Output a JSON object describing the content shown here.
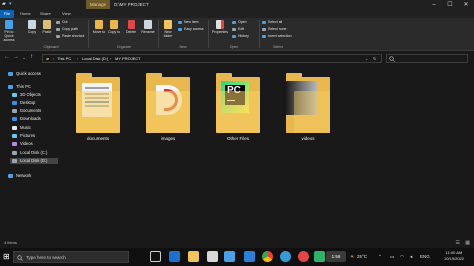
{
  "window": {
    "title": "D:\\MY PROJECT",
    "manage_tab": "Manage",
    "picture_tools_tab": "Picture Tools",
    "controls": [
      "–",
      "☐",
      "✕"
    ]
  },
  "ribbon": {
    "tabs": [
      "File",
      "Home",
      "Share",
      "View"
    ],
    "clipboard": {
      "pin_label": "Pin to Quick access",
      "copy_label": "Copy",
      "paste_label": "Paste",
      "cut_label": "Cut",
      "copy_path_label": "Copy path",
      "paste_shortcut_label": "Paste shortcut",
      "group_label": "Clipboard"
    },
    "organize": {
      "move_to_label": "Move to",
      "copy_to_label": "Copy to",
      "delete_label": "Delete",
      "rename_label": "Rename",
      "group_label": "Organize"
    },
    "new": {
      "new_folder_label": "New folder",
      "new_item_label": "New item",
      "easy_access_label": "Easy access",
      "group_label": "New"
    },
    "open": {
      "properties_label": "Properties",
      "open_label": "Open",
      "edit_label": "Edit",
      "history_label": "History",
      "group_label": "Open"
    },
    "select": {
      "select_all_label": "Select all",
      "select_none_label": "Select none",
      "invert_selection_label": "Invert selection",
      "group_label": "Select"
    }
  },
  "navigation": {
    "crumbs": [
      "This PC",
      "Local Disk (D:)",
      "MY PROJECT"
    ]
  },
  "sidebar": {
    "items": [
      {
        "label": "Quick access",
        "icon": "star-icon",
        "color": "#4aa0e6"
      },
      {
        "label": "This PC",
        "icon": "computer-icon",
        "color": "#4aa0e6"
      },
      {
        "label": "3D Objects",
        "icon": "cube-icon",
        "color": "#6ec6f0"
      },
      {
        "label": "Desktop",
        "icon": "desktop-icon",
        "color": "#3a8ee6"
      },
      {
        "label": "Documents",
        "icon": "documents-icon",
        "color": "#9aa4b0"
      },
      {
        "label": "Downloads",
        "icon": "download-icon",
        "color": "#3a8ee6"
      },
      {
        "label": "Music",
        "icon": "music-icon",
        "color": "#e6e6e6"
      },
      {
        "label": "Pictures",
        "icon": "pictures-icon",
        "color": "#6ec6f0"
      },
      {
        "label": "Videos",
        "icon": "videos-icon",
        "color": "#b48ce6"
      },
      {
        "label": "Local Disk (C:)",
        "icon": "drive-icon",
        "color": "#9aa4b0"
      },
      {
        "label": "Local Disk (D:)",
        "icon": "drive-icon",
        "color": "#9aa4b0"
      },
      {
        "label": "Network",
        "icon": "network-icon",
        "color": "#4aa0e6"
      }
    ]
  },
  "folders": [
    {
      "name": "documents",
      "thumb": "documents-thumb"
    },
    {
      "name": "images",
      "thumb": "images-thumb"
    },
    {
      "name": "Other Files",
      "thumb": "pycharm-thumb"
    },
    {
      "name": "videos",
      "thumb": "video-thumb"
    }
  ],
  "statusbar": {
    "items_count": "4 items"
  },
  "taskbar": {
    "search_placeholder": "Type here to search",
    "badge": "1:56",
    "temperature": "25°C",
    "language": "ENG",
    "time": "11:00 AM",
    "date": "10/19/2022"
  }
}
